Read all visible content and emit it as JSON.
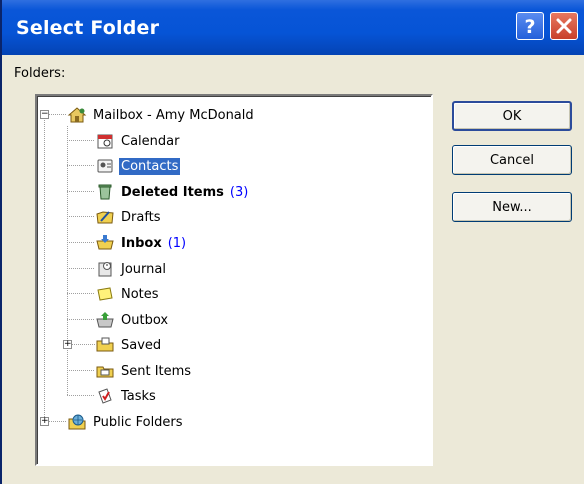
{
  "window": {
    "title": "Select Folder"
  },
  "titlebar_buttons": {
    "help": "?",
    "close": "X"
  },
  "folders_label": "Folders:",
  "tree": {
    "root": {
      "label": "Mailbox - Amy McDonald",
      "expanded": true
    },
    "items": [
      {
        "label": "Calendar",
        "bold": false,
        "count": "",
        "icon": "calendar-icon"
      },
      {
        "label": "Contacts",
        "bold": false,
        "count": "",
        "icon": "contacts-icon",
        "selected": true
      },
      {
        "label": "Deleted Items",
        "bold": true,
        "count": "(3)",
        "icon": "deleted-items-icon"
      },
      {
        "label": "Drafts",
        "bold": false,
        "count": "",
        "icon": "drafts-icon"
      },
      {
        "label": "Inbox",
        "bold": true,
        "count": "(1)",
        "icon": "inbox-icon"
      },
      {
        "label": "Journal",
        "bold": false,
        "count": "",
        "icon": "journal-icon"
      },
      {
        "label": "Notes",
        "bold": false,
        "count": "",
        "icon": "notes-icon"
      },
      {
        "label": "Outbox",
        "bold": false,
        "count": "",
        "icon": "outbox-icon"
      },
      {
        "label": "Saved",
        "bold": false,
        "count": "",
        "icon": "saved-folder-icon",
        "expandable": true
      },
      {
        "label": "Sent Items",
        "bold": false,
        "count": "",
        "icon": "sent-items-icon"
      },
      {
        "label": "Tasks",
        "bold": false,
        "count": "",
        "icon": "tasks-icon"
      }
    ],
    "public": {
      "label": "Public Folders",
      "expandable": true
    }
  },
  "buttons": {
    "ok": "OK",
    "cancel": "Cancel",
    "new": "New..."
  },
  "colors": {
    "title_bar": "#0654d6",
    "selection": "#316ac5",
    "count": "#0000ff",
    "dialog_bg": "#ece9d8"
  }
}
